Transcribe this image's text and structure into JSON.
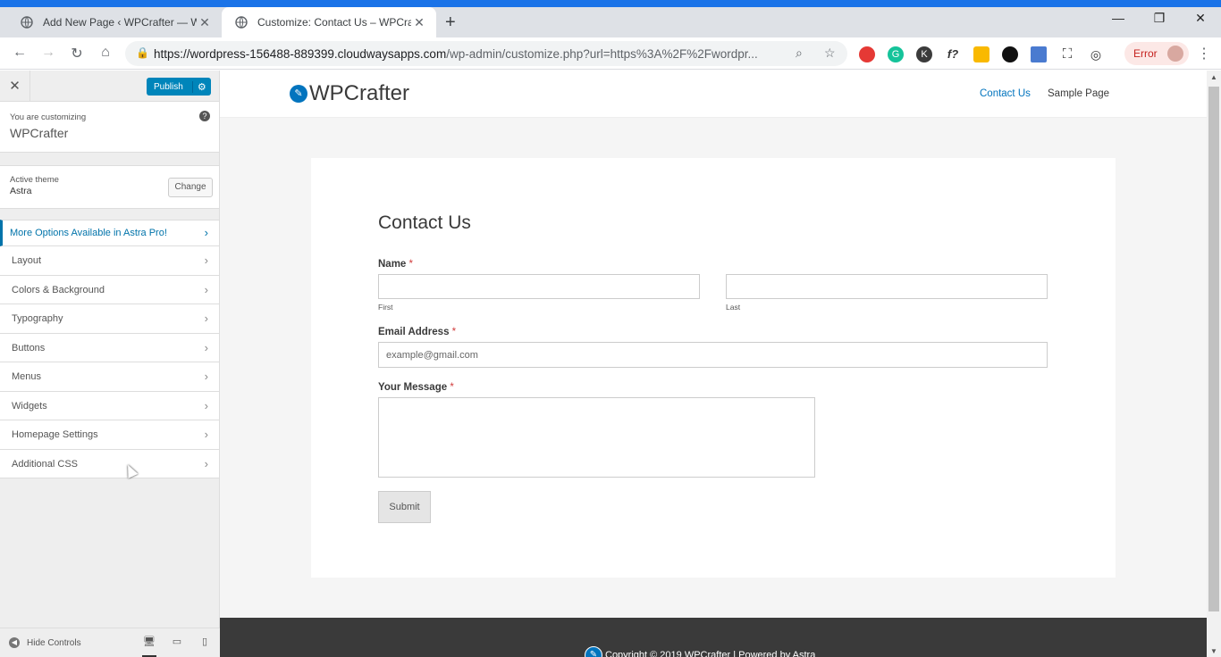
{
  "browser": {
    "tabs": [
      {
        "title": "Add New Page ‹ WPCrafter — W",
        "active": false
      },
      {
        "title": "Customize: Contact Us – WPCraft",
        "active": true
      }
    ],
    "url_domain": "https://wordpress-156488-889399.cloudwaysapps.com",
    "url_path": "/wp-admin/customize.php?url=https%3A%2F%2Fwordpr...",
    "error_label": "Error",
    "accent": "#1a73e8"
  },
  "sidebar": {
    "publish_label": "Publish",
    "customizing_label": "You are customizing",
    "site_name": "WPCrafter",
    "active_theme_label": "Active theme",
    "theme_name": "Astra",
    "change_label": "Change",
    "pro_link": "More Options Available in Astra Pro!",
    "items": [
      {
        "label": "Layout"
      },
      {
        "label": "Colors & Background"
      },
      {
        "label": "Typography"
      },
      {
        "label": "Buttons"
      },
      {
        "label": "Menus"
      },
      {
        "label": "Widgets"
      },
      {
        "label": "Homepage Settings"
      },
      {
        "label": "Additional CSS"
      }
    ],
    "hide_controls": "Hide Controls"
  },
  "preview": {
    "site_title": "WPCrafter",
    "nav": [
      {
        "label": "Contact Us",
        "current": true
      },
      {
        "label": "Sample Page",
        "current": false
      }
    ],
    "page_title": "Contact Us",
    "form": {
      "name_label": "Name",
      "required_mark": "*",
      "first_sub": "First",
      "last_sub": "Last",
      "email_label": "Email Address",
      "email_placeholder": "example@gmail.com",
      "message_label": "Your Message",
      "submit_label": "Submit"
    },
    "footer_text": "Copyright © 2019 WPCrafter | Powered by Astra",
    "link_color": "#0274be"
  }
}
